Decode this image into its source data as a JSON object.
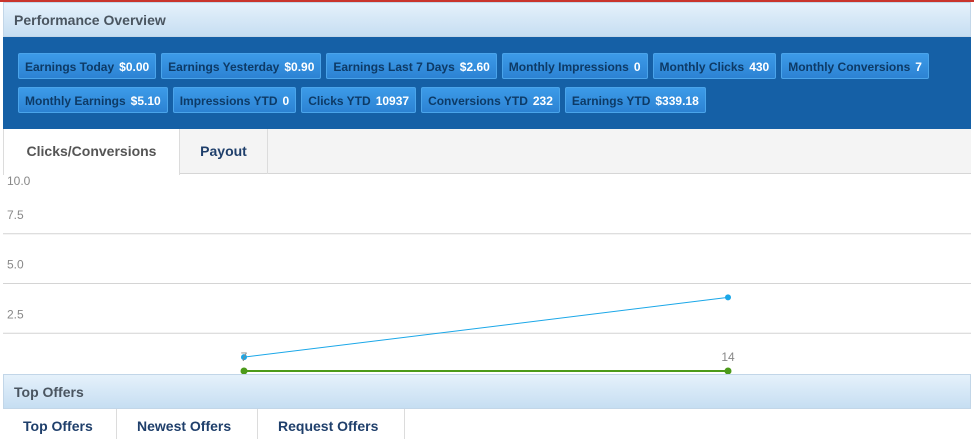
{
  "performance": {
    "title": "Performance Overview",
    "stats_row1": [
      {
        "label": "Earnings Today",
        "value": "$0.00"
      },
      {
        "label": "Earnings Yesterday",
        "value": "$0.90"
      },
      {
        "label": "Earnings Last 7 Days",
        "value": "$2.60"
      },
      {
        "label": "Monthly Impressions",
        "value": "0"
      },
      {
        "label": "Monthly Clicks",
        "value": "430"
      },
      {
        "label": "Monthly Conversions",
        "value": "7"
      }
    ],
    "stats_row2": [
      {
        "label": "Monthly Earnings",
        "value": "$5.10"
      },
      {
        "label": "Impressions YTD",
        "value": "0"
      },
      {
        "label": "Clicks YTD",
        "value": "10937"
      },
      {
        "label": "Conversions YTD",
        "value": "232"
      },
      {
        "label": "Earnings YTD",
        "value": "$339.18"
      }
    ],
    "tabs": [
      {
        "label": "Clicks/Conversions",
        "active": true
      },
      {
        "label": "Payout",
        "active": false
      }
    ]
  },
  "chart_data": {
    "type": "line",
    "title": "",
    "xlabel": "",
    "ylabel": "",
    "ylim": [
      0,
      10
    ],
    "y_ticks": [
      "2.5",
      "5.0",
      "7.5",
      "10.0"
    ],
    "grid": true,
    "series": [
      {
        "values": [
          1.3,
          4.3
        ],
        "color": "#1aa7e8"
      },
      {
        "values": [
          0,
          0
        ],
        "color": "#4c9a1a",
        "data_labels": [
          "7",
          "14"
        ]
      }
    ]
  },
  "top_offers": {
    "title": "Top Offers",
    "tabs": [
      "Top Offers",
      "Newest Offers",
      "Request Offers"
    ]
  },
  "colors": {
    "accent": "#1560a6",
    "line_primary": "#1aa7e8",
    "line_secondary": "#4c9a1a"
  }
}
